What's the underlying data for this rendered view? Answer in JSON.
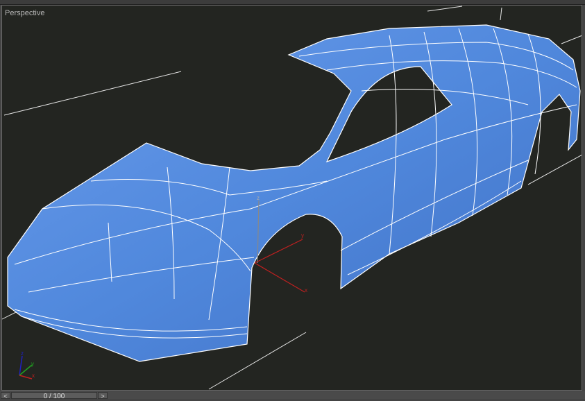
{
  "viewport": {
    "label": "Perspective"
  },
  "gizmo": {
    "x_label": "x",
    "y_label": "y",
    "z_label": "z"
  },
  "axis_tripod": {
    "x_label": "x",
    "y_label": "y",
    "z_label": "z"
  },
  "timeline": {
    "prev_label": "<",
    "next_label": ">",
    "frame_display": "0 / 100"
  },
  "colors": {
    "background": "#232521",
    "body": "#5b8ee0",
    "wire": "#ffffff",
    "gizmo": "#c02020"
  }
}
